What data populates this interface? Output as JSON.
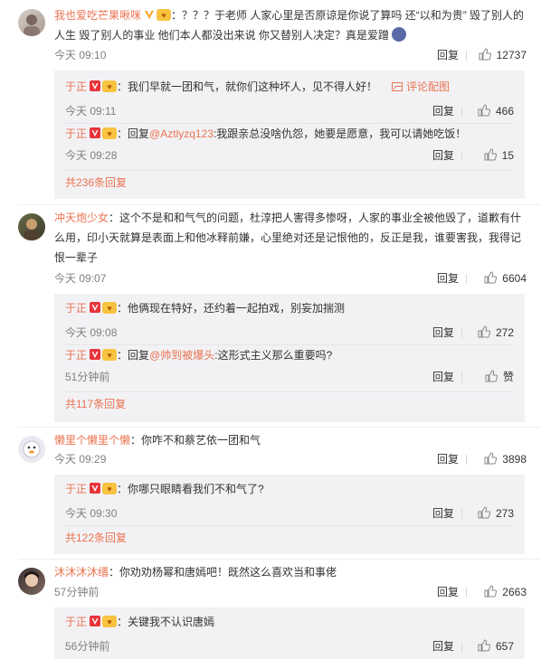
{
  "colors": {
    "username": "#eb7350",
    "box_bg": "#f2f2f5",
    "meta": "#808080"
  },
  "icons": {
    "like": "thumbs-up-icon",
    "verified": "verified-v-icon",
    "fans": "fans-badge-icon",
    "pic": "picture-icon"
  },
  "comments": [
    {
      "user": "我也爱吃芒果啾咪",
      "text1": "？？？于老师 人家心里是否原谅是你说了算吗  还“以和为贵” 毁了别人的",
      "text2": "人生  毁了别人的事业    他们本人都没出来说  你又替别人决定？真是爱蹭",
      "time": "今天 09:10",
      "reply": "回复",
      "likes": "12737",
      "replies": [
        {
          "user": "于正",
          "text": "我们早就一团和气，就你们这种坏人，见不得人好！",
          "pic_link": "评论配图",
          "time": "今天 09:11",
          "reply": "回复",
          "likes": "466"
        },
        {
          "user": "于正",
          "reply_prefix": "回复",
          "mention": "@Aztlyzq123",
          "text": ":我跟亲总没啥仇怨，她要是愿意，我可以请她吃饭！",
          "time": "今天 09:28",
          "reply": "回复",
          "likes": "15"
        }
      ],
      "more": "共236条回复"
    },
    {
      "user": "冲天炮少女",
      "text1": "这个不是和和气气的问题，杜淳把人害得多惨呀，人家的事业全被他毁了，道歉有什",
      "text2": "么用，印小天就算是表面上和他冰释前嫌，心里绝对还是记恨他的，反正是我，谁要害我，我得记",
      "text3": "恨一辈子",
      "time": "今天 09:07",
      "reply": "回复",
      "likes": "6604",
      "replies": [
        {
          "user": "于正",
          "text": "他俩现在特好，还约着一起拍戏，别妄加揣测",
          "time": "今天 09:08",
          "reply": "回复",
          "likes": "272"
        },
        {
          "user": "于正",
          "reply_prefix": "回复",
          "mention": "@帅到被爆头",
          "text": ":这形式主义那么重要吗?",
          "time": "51分钟前",
          "reply": "回复",
          "likes": "赞"
        }
      ],
      "more": "共117条回复"
    },
    {
      "user": "懒里个懒里个懒",
      "text1": "你咋不和蔡艺依一团和气",
      "time": "今天 09:29",
      "reply": "回复",
      "likes": "3898",
      "replies": [
        {
          "user": "于正",
          "text": "你哪只眼睛看我们不和气了?",
          "time": "今天 09:30",
          "reply": "回复",
          "likes": "273"
        }
      ],
      "more": "共122条回复"
    },
    {
      "user": "沐沐沐沐缙",
      "text1": "你劝劝杨幂和唐嫣吧！既然这么喜欢当和事佬",
      "time": "57分钟前",
      "reply": "回复",
      "likes": "2663",
      "replies": [
        {
          "user": "于正",
          "text": "关键我不认识唐嫣",
          "time": "56分钟前",
          "reply": "回复",
          "likes": "657"
        }
      ]
    }
  ]
}
